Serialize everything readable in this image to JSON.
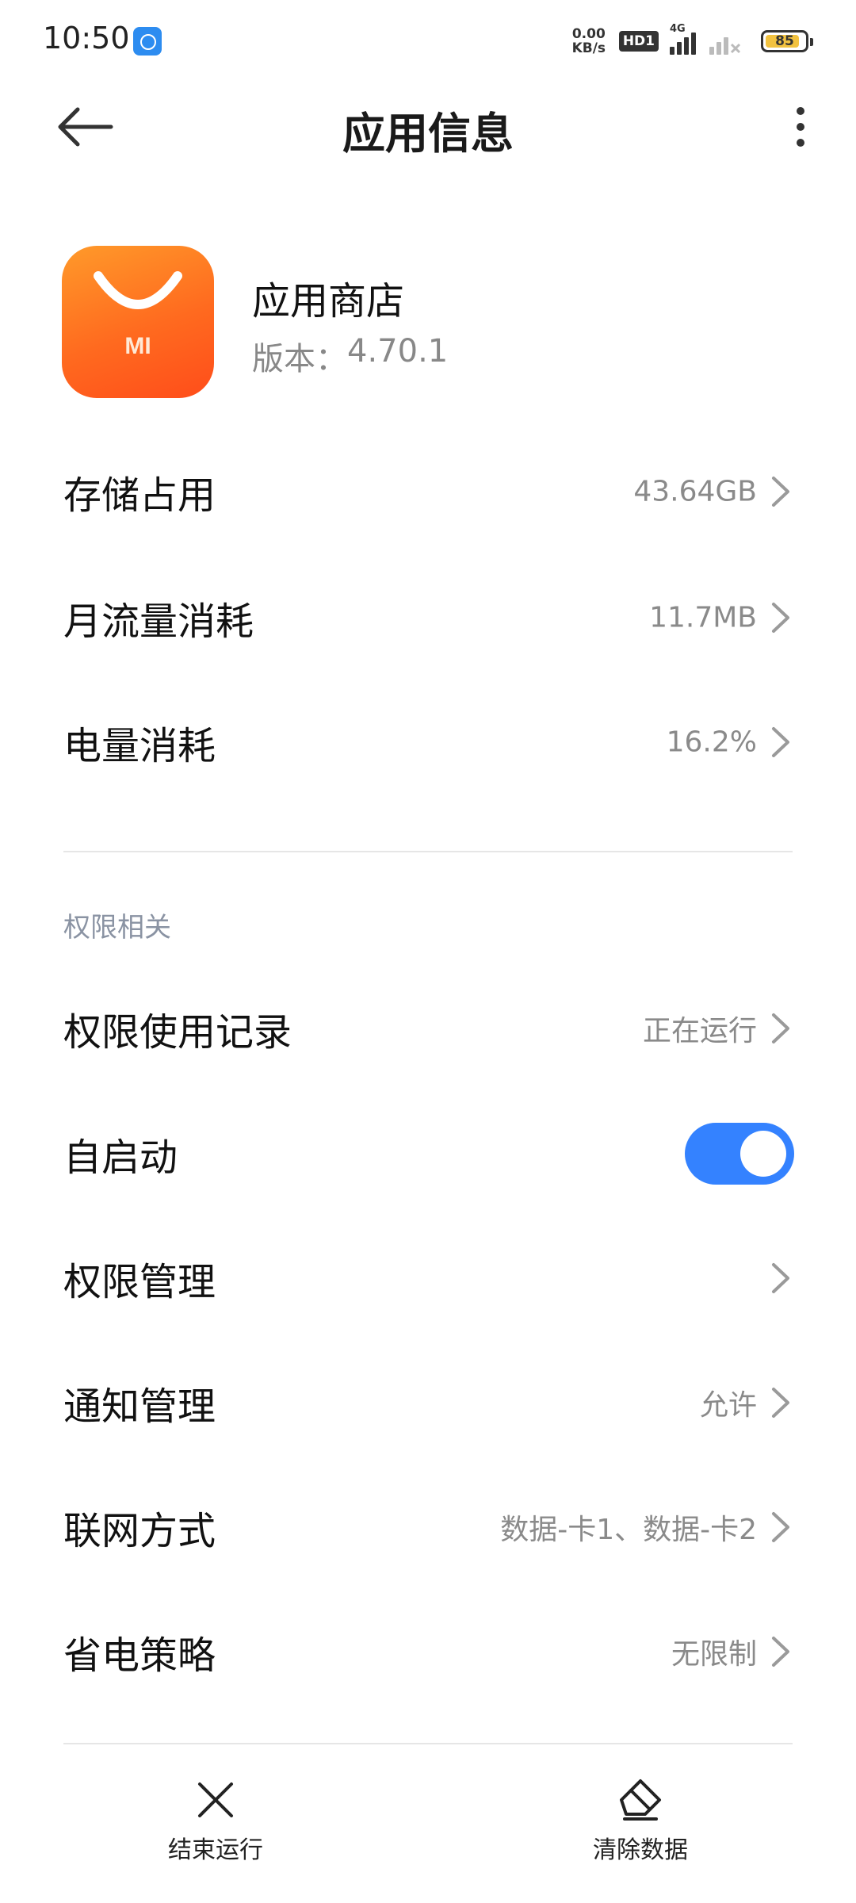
{
  "status_bar": {
    "time": "10:50",
    "net_speed_value": "0.00",
    "net_speed_unit": "KB/s",
    "hd_badge": "HD1",
    "network_type": "4G",
    "battery_level": "85"
  },
  "header": {
    "title": "应用信息"
  },
  "app": {
    "name": "应用商店",
    "version_label": "版本：",
    "version": "4.70.1",
    "logo_text": "MI"
  },
  "usage_rows": [
    {
      "label": "存储占用",
      "value": "43.64GB"
    },
    {
      "label": "月流量消耗",
      "value": "11.7MB"
    },
    {
      "label": "电量消耗",
      "value": "16.2%"
    }
  ],
  "permissions_section": {
    "header": "权限相关",
    "rows": [
      {
        "label": "权限使用记录",
        "value": "正在运行"
      },
      {
        "label": "自启动",
        "toggle_on": true
      },
      {
        "label": "权限管理",
        "value": ""
      },
      {
        "label": "通知管理",
        "value": "允许"
      },
      {
        "label": "联网方式",
        "value": "数据-卡1、数据-卡2"
      },
      {
        "label": "省电策略",
        "value": "无限制"
      }
    ]
  },
  "bottom_bar": {
    "force_stop": "结束运行",
    "clear_data": "清除数据"
  },
  "colors": {
    "accent": "#3482ff",
    "app_icon_start": "#ff9a2a",
    "app_icon_end": "#ff4d1a",
    "secondary_text": "#8a8a8a"
  }
}
